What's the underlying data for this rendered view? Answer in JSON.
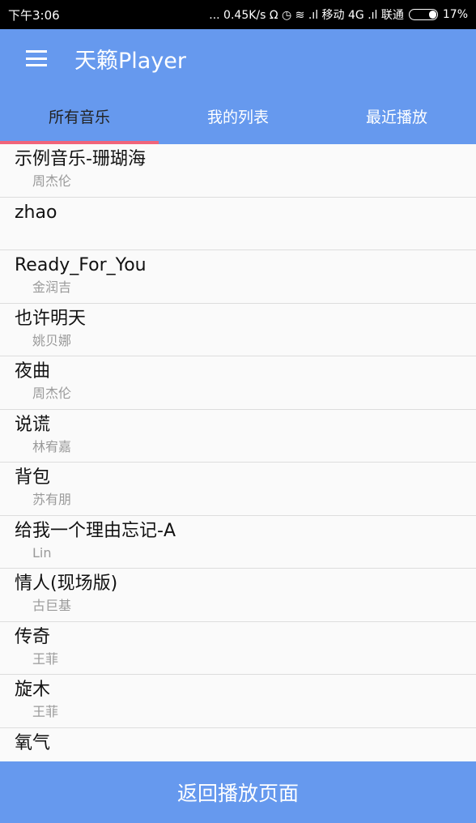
{
  "status_bar": {
    "time": "下午3:06",
    "indicators": "... 0.45K/s Ω ◷ ≋ .ıl 移动 4G .ıl 联通",
    "battery": "17%"
  },
  "app_bar": {
    "menu_icon": "hamburger-icon",
    "title": "天籁Player"
  },
  "tabs": [
    {
      "label": "所有音乐",
      "active": true
    },
    {
      "label": "我的列表",
      "active": false
    },
    {
      "label": "最近播放",
      "active": false
    }
  ],
  "songs": [
    {
      "title": "示例音乐-珊瑚海",
      "artist": "周杰伦"
    },
    {
      "title": "zhao",
      "artist": ""
    },
    {
      "title": "Ready_For_You",
      "artist": "金润吉"
    },
    {
      "title": "也许明天",
      "artist": "姚贝娜"
    },
    {
      "title": "夜曲",
      "artist": "周杰伦"
    },
    {
      "title": "说谎",
      "artist": "林宥嘉"
    },
    {
      "title": "背包",
      "artist": "苏有朋"
    },
    {
      "title": "给我一个理由忘记-A",
      "artist": "Lin"
    },
    {
      "title": "情人(现场版)",
      "artist": "古巨基"
    },
    {
      "title": "传奇",
      "artist": "王菲"
    },
    {
      "title": "旋木",
      "artist": "王菲"
    },
    {
      "title": "氧气",
      "artist": ""
    }
  ],
  "bottom_button": {
    "label": "返回播放页面"
  },
  "colors": {
    "primary": "#6699ee",
    "tab_indicator": "#f0647a",
    "artist_text": "#9a9a9a"
  }
}
